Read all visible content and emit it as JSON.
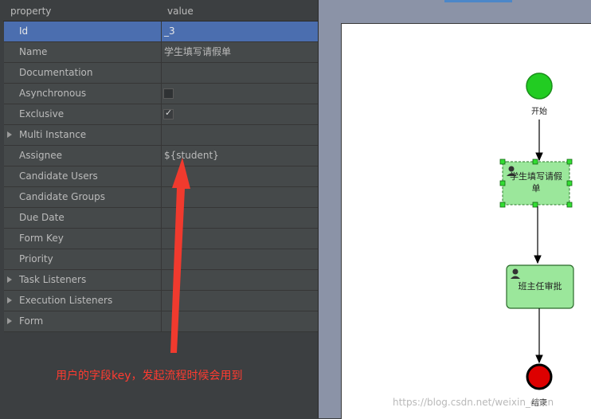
{
  "properties": {
    "header": {
      "col1": "property",
      "col2": "value"
    },
    "rows": [
      {
        "name": "Id",
        "value": "_3",
        "type": "text",
        "selected": true
      },
      {
        "name": "Name",
        "value": "学生填写请假单",
        "type": "text"
      },
      {
        "name": "Documentation",
        "value": "",
        "type": "text"
      },
      {
        "name": "Asynchronous",
        "value": "",
        "type": "checkbox",
        "checked": false
      },
      {
        "name": "Exclusive",
        "value": "",
        "type": "checkbox",
        "checked": true
      },
      {
        "name": "Multi Instance",
        "value": "",
        "type": "group"
      },
      {
        "name": "Assignee",
        "value": "${student}",
        "type": "text"
      },
      {
        "name": "Candidate Users",
        "value": "",
        "type": "text"
      },
      {
        "name": "Candidate Groups",
        "value": "",
        "type": "text"
      },
      {
        "name": "Due Date",
        "value": "",
        "type": "text"
      },
      {
        "name": "Form Key",
        "value": "",
        "type": "text"
      },
      {
        "name": "Priority",
        "value": "",
        "type": "text"
      },
      {
        "name": "Task Listeners",
        "value": "",
        "type": "group"
      },
      {
        "name": "Execution Listeners",
        "value": "",
        "type": "group"
      },
      {
        "name": "Form",
        "value": "",
        "type": "group"
      }
    ]
  },
  "annotation": {
    "text": "用户的字段key，发起流程时候会用到",
    "color": "#ff3b30"
  },
  "diagram": {
    "start_label": "开始",
    "task1_label_line1": "学生填写请假",
    "task1_label_line2": "单",
    "task2_label": "班主任审批",
    "end_label": "结束",
    "start_color": "#22cc22",
    "end_color": "#dd0000",
    "task_color": "#9be79b"
  },
  "watermark": "https://blog.csdn.net/weixin_chen"
}
